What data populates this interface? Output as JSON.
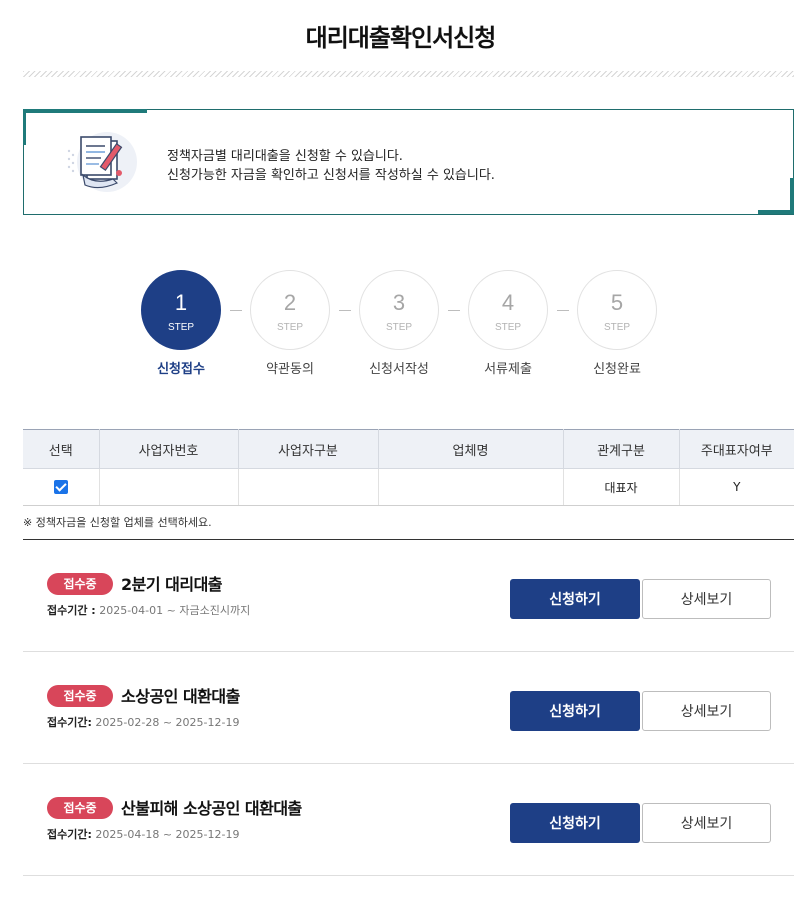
{
  "page": {
    "title": "대리대출확인서신청"
  },
  "info": {
    "line1": "정책자금별 대리대출을 신청할 수 있습니다.",
    "line2": "신청가능한 자금을 확인하고 신청서를 작성하실 수 있습니다."
  },
  "steps": [
    {
      "num": "1",
      "step": "STEP",
      "label": "신청접수",
      "active": true
    },
    {
      "num": "2",
      "step": "STEP",
      "label": "약관동의",
      "active": false
    },
    {
      "num": "3",
      "step": "STEP",
      "label": "신청서작성",
      "active": false
    },
    {
      "num": "4",
      "step": "STEP",
      "label": "서류제출",
      "active": false
    },
    {
      "num": "5",
      "step": "STEP",
      "label": "신청완료",
      "active": false
    }
  ],
  "table": {
    "headers": [
      "선택",
      "사업자번호",
      "사업자구분",
      "업체명",
      "관계구분",
      "주대표자여부"
    ],
    "rows": [
      {
        "checked": true,
        "biz_no": "",
        "biz_type": "",
        "company": "",
        "relation": "대표자",
        "main_rep": "Y"
      }
    ]
  },
  "note": "※ 정책자금을 신청할 업체를 선택하세요.",
  "loans": [
    {
      "badge": "접수중",
      "title": "2분기 대리대출",
      "period_label": "접수기간 :",
      "period": "2025-04-01 ~ 자금소진시까지",
      "apply": "신청하기",
      "detail": "상세보기"
    },
    {
      "badge": "접수중",
      "title": "소상공인 대환대출",
      "period_label": "접수기간:",
      "period": "2025-02-28 ~ 2025-12-19",
      "apply": "신청하기",
      "detail": "상세보기"
    },
    {
      "badge": "접수중",
      "title": "산불피해 소상공인 대환대출",
      "period_label": "접수기간:",
      "period": "2025-04-18 ~ 2025-12-19",
      "apply": "신청하기",
      "detail": "상세보기"
    }
  ],
  "colors": {
    "primary": "#1e3f86",
    "badge": "#d8465a",
    "accent": "#1f7a7a"
  },
  "icons": {
    "info": "document-pen-icon",
    "check": "checkbox-checked-icon"
  }
}
